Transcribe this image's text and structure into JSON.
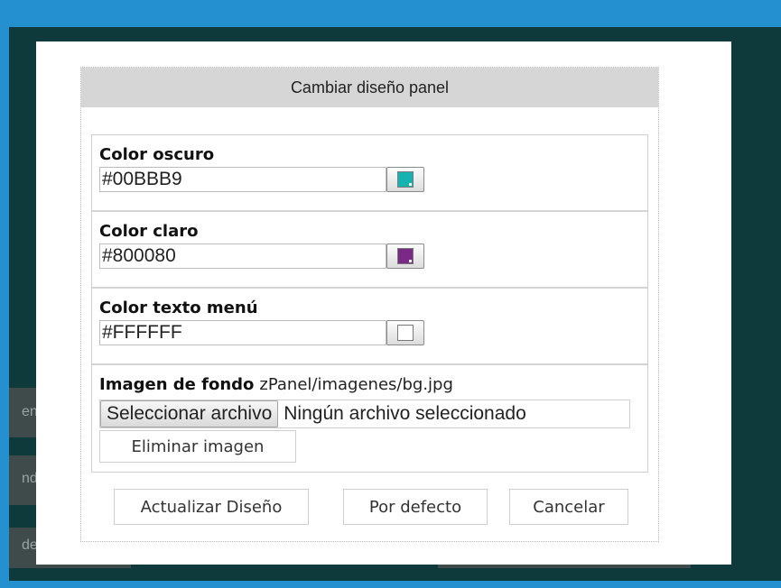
{
  "background": {
    "partial_labels": [
      "en",
      "nd",
      "de"
    ]
  },
  "dialog": {
    "title": "Cambiar diseño panel",
    "fields": [
      {
        "label": "Color oscuro",
        "value": "#00BBB9",
        "swatch": "#17b3b0"
      },
      {
        "label": "Color claro",
        "value": "#800080",
        "swatch": "#7a2a86"
      },
      {
        "label": "Color texto menú",
        "value": "#FFFFFF",
        "swatch": "#ffffff"
      }
    ],
    "image": {
      "label": "Imagen de fondo",
      "path": "zPanel/imagenes/bg.jpg",
      "file_button": "Seleccionar archivo",
      "file_status": "Ningún archivo seleccionado",
      "remove_button": "Eliminar imagen"
    },
    "actions": {
      "update": "Actualizar Diseño",
      "default": "Por defecto",
      "cancel": "Cancelar"
    }
  }
}
